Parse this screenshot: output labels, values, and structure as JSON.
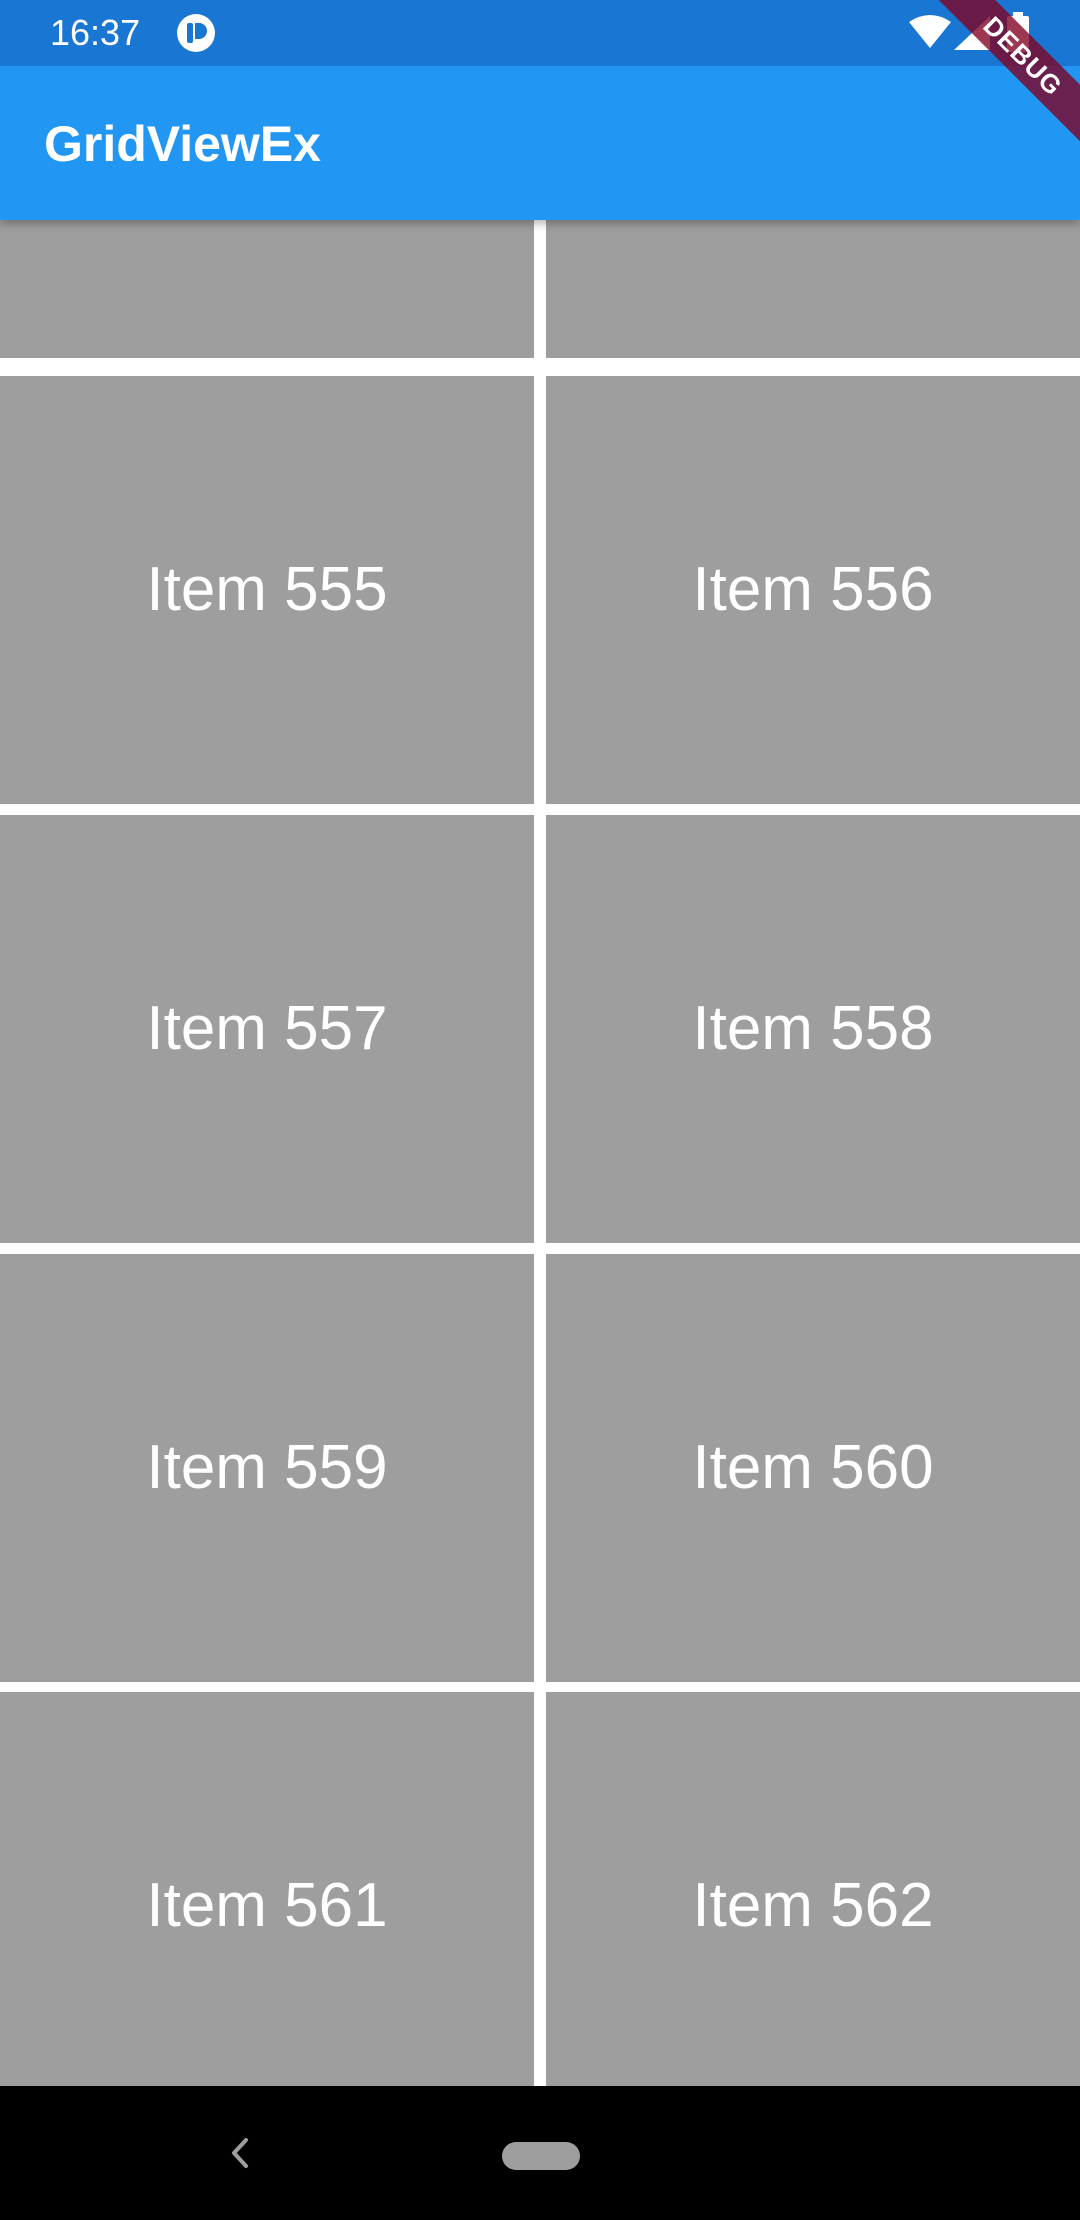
{
  "status_bar": {
    "time": "16:37",
    "app_icon": "notification-app-icon",
    "wifi_icon": "wifi-icon",
    "signal_icon": "cell-signal-icon",
    "battery_icon": "battery-icon"
  },
  "app_bar": {
    "title": "GridViewEx",
    "color": "#2196F3"
  },
  "debug_banner": {
    "label": "DEBUG"
  },
  "grid": {
    "cell_color": "#9E9E9E",
    "items": [
      {
        "label": ""
      },
      {
        "label": ""
      },
      {
        "label": "Item 555"
      },
      {
        "label": "Item 556"
      },
      {
        "label": "Item 557"
      },
      {
        "label": "Item 558"
      },
      {
        "label": "Item 559"
      },
      {
        "label": "Item 560"
      },
      {
        "label": "Item 561"
      },
      {
        "label": "Item 562"
      }
    ]
  },
  "nav_bar": {
    "back_icon": "back-chevron-icon",
    "home_icon": "home-pill-icon"
  }
}
